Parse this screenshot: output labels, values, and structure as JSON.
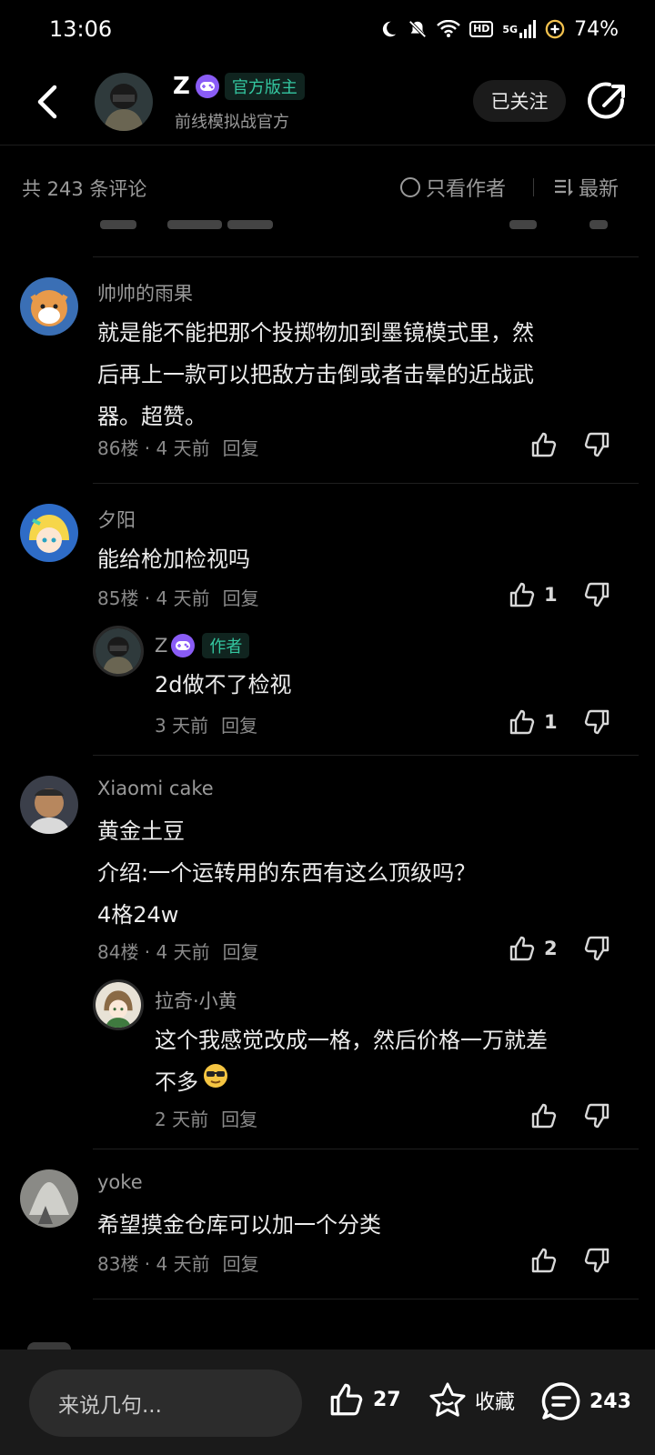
{
  "status_bar": {
    "time": "13:06",
    "network": "5G",
    "hd": "HD",
    "battery": "74%"
  },
  "header": {
    "author_name": "Z",
    "badge": "官方版主",
    "subtitle": "前线模拟战官方",
    "follow_label": "已关注"
  },
  "filter": {
    "count_label": "共 243 条评论",
    "author_only_label": "只看作者",
    "sort_label": "最新"
  },
  "comments": [
    {
      "user": "帅帅的雨果",
      "text_lines": [
        "就是能不能把那个投掷物加到墨镜模式里，然",
        "后再上一款可以把敌方击倒或者击晕的近战武",
        "器。超赞。"
      ],
      "meta": "86楼 · 4 天前",
      "reply": "回复",
      "likes": ""
    },
    {
      "user": "夕阳",
      "text_lines": [
        "能给枪加检视吗"
      ],
      "meta": "85楼 · 4 天前",
      "reply": "回复",
      "likes": "1",
      "sub_reply": {
        "user": "Z",
        "tag": "作者",
        "text": "2d做不了检视",
        "meta": "3 天前",
        "reply": "回复",
        "likes": "1"
      }
    },
    {
      "user": "Xiaomi cake",
      "text_lines": [
        "黄金土豆",
        "介绍:一个运转用的东西有这么顶级吗？",
        "4格24w"
      ],
      "meta": "84楼 · 4 天前",
      "reply": "回复",
      "likes": "2",
      "sub_reply": {
        "user": "拉奇·小黄",
        "text_lines": [
          "这个我感觉改成一格，然后价格一万就差",
          "不多"
        ],
        "meta": "2 天前",
        "reply": "回复",
        "likes": ""
      }
    },
    {
      "user": "yoke",
      "text_lines": [
        "希望摸金仓库可以加一个分类"
      ],
      "meta": "83楼 · 4 天前",
      "reply": "回复",
      "likes": ""
    }
  ],
  "bottom_bar": {
    "input_placeholder": "来说几句...",
    "like_count": "27",
    "favorite_label": "收藏",
    "comment_count": "243"
  },
  "colors": {
    "background": "#000000",
    "accent_green": "#34c7a0",
    "badge_purple": "#8a5cf6",
    "bottom_bar": "#1a1a1a"
  }
}
